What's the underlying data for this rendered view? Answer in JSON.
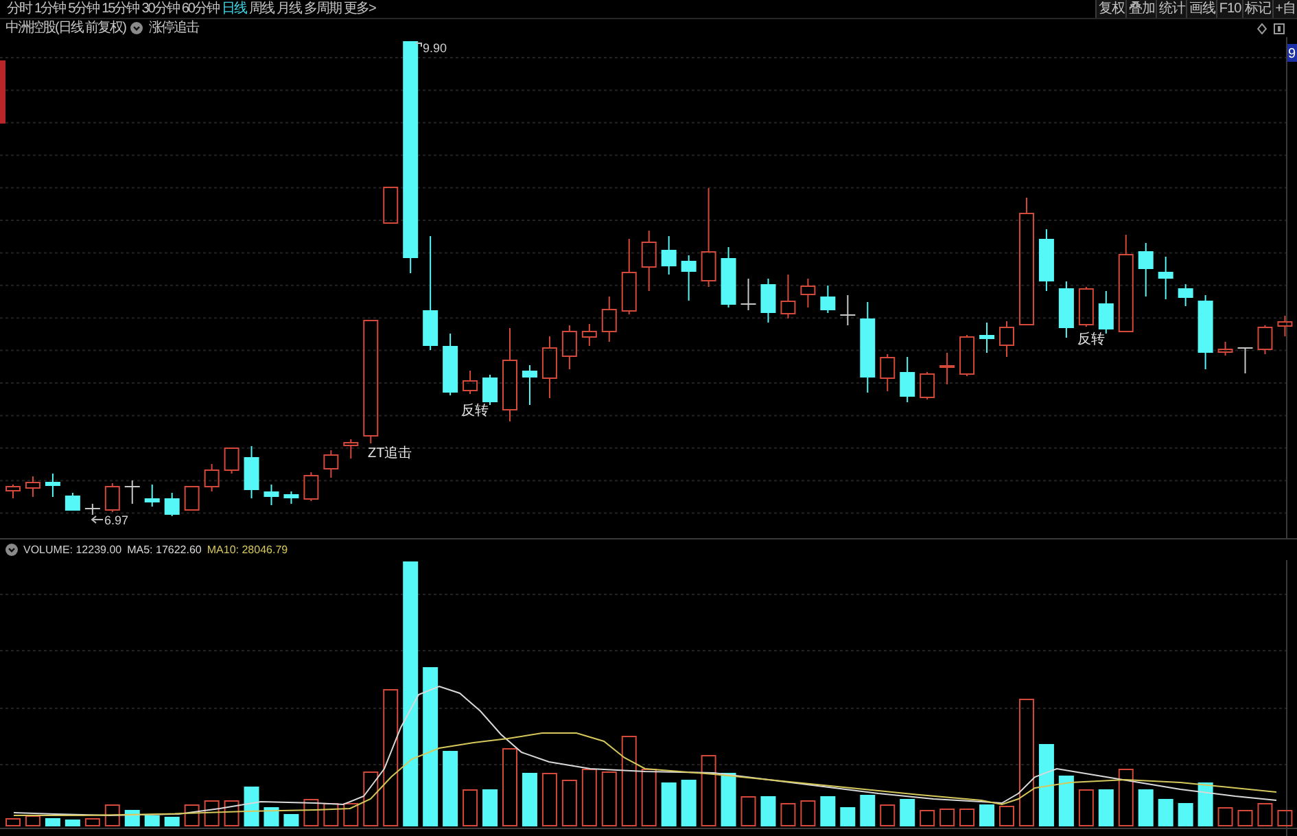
{
  "toolbar": {
    "periods": [
      {
        "label": "分时",
        "selected": false
      },
      {
        "label": "1分钟",
        "selected": false
      },
      {
        "label": "5分钟",
        "selected": false
      },
      {
        "label": "15分钟",
        "selected": false
      },
      {
        "label": "30分钟",
        "selected": false
      },
      {
        "label": "60分钟",
        "selected": false
      },
      {
        "label": "日线",
        "selected": true
      },
      {
        "label": "周线",
        "selected": false
      },
      {
        "label": "月线",
        "selected": false
      },
      {
        "label": "多周期",
        "selected": false
      }
    ],
    "more": "更多>",
    "tools": [
      "复权",
      "叠加",
      "统计",
      "画线",
      "F10",
      "标记",
      "+自"
    ]
  },
  "title_bar": {
    "stock_title": "中洲控股(日线 前复权)",
    "indicator": "涨停追击"
  },
  "price_chart": {
    "high_label": "9.90",
    "low_label": "6.97",
    "signals": [
      {
        "text": "ZT追击"
      },
      {
        "text": "反转"
      },
      {
        "text": "反转"
      }
    ],
    "axis_label": "9"
  },
  "volume_panel": {
    "title": "VOLUME: 12239.00",
    "ma_readings": [
      {
        "text": "MA5: 17622.60",
        "color": "#d9d9d9"
      },
      {
        "text": "MA10: 28046.79",
        "color": "#d6c85a"
      }
    ]
  }
}
